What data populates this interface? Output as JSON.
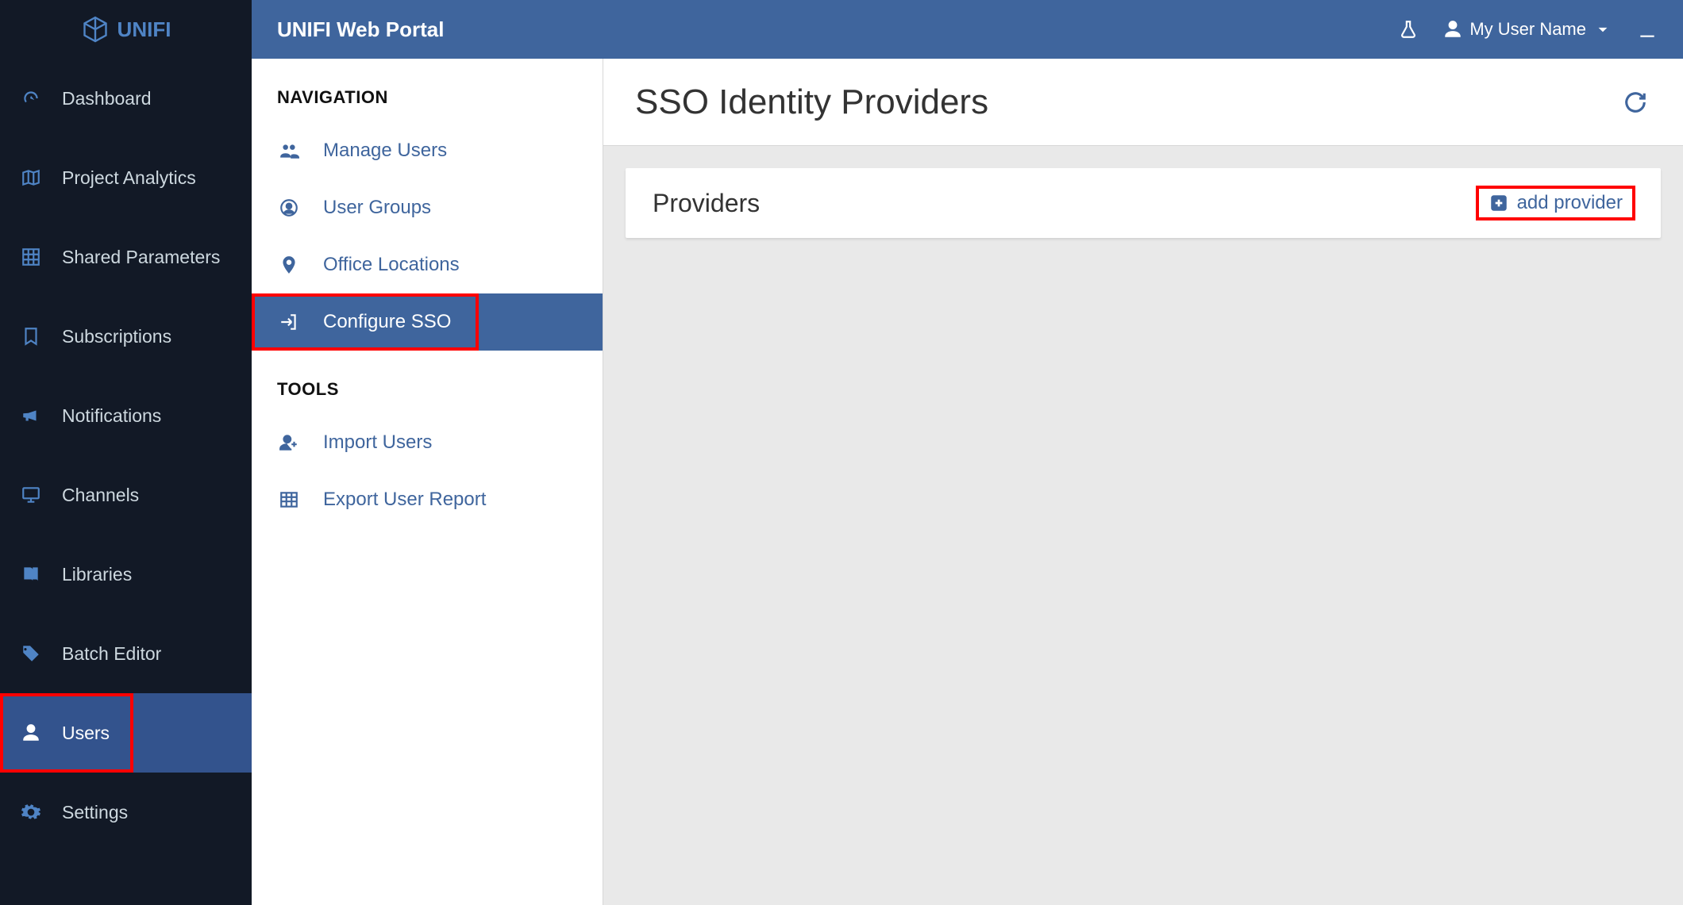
{
  "brand": {
    "name": "UNIFI"
  },
  "topbar": {
    "title": "UNIFI Web Portal",
    "user_label": "My User Name"
  },
  "sidebar": {
    "items": [
      {
        "label": "Dashboard",
        "icon": "gauge-icon"
      },
      {
        "label": "Project Analytics",
        "icon": "map-icon"
      },
      {
        "label": "Shared Parameters",
        "icon": "grid-icon"
      },
      {
        "label": "Subscriptions",
        "icon": "bookmark-icon"
      },
      {
        "label": "Notifications",
        "icon": "megaphone-icon"
      },
      {
        "label": "Channels",
        "icon": "monitor-icon"
      },
      {
        "label": "Libraries",
        "icon": "book-icon"
      },
      {
        "label": "Batch Editor",
        "icon": "tag-icon"
      },
      {
        "label": "Users",
        "icon": "user-icon",
        "active": true,
        "highlight": true
      },
      {
        "label": "Settings",
        "icon": "gear-icon"
      }
    ]
  },
  "nav": {
    "sections": [
      {
        "title": "NAVIGATION",
        "items": [
          {
            "label": "Manage Users",
            "icon": "users-icon"
          },
          {
            "label": "User Groups",
            "icon": "user-circle-icon"
          },
          {
            "label": "Office Locations",
            "icon": "pin-icon"
          },
          {
            "label": "Configure SSO",
            "icon": "signin-icon",
            "active": true,
            "highlight": true
          }
        ]
      },
      {
        "title": "TOOLS",
        "items": [
          {
            "label": "Import Users",
            "icon": "user-plus-icon"
          },
          {
            "label": "Export User Report",
            "icon": "table-icon"
          }
        ]
      }
    ]
  },
  "page": {
    "title": "SSO Identity Providers",
    "card_title": "Providers",
    "add_provider_label": "add provider"
  },
  "highlight_color": "#ff0000"
}
